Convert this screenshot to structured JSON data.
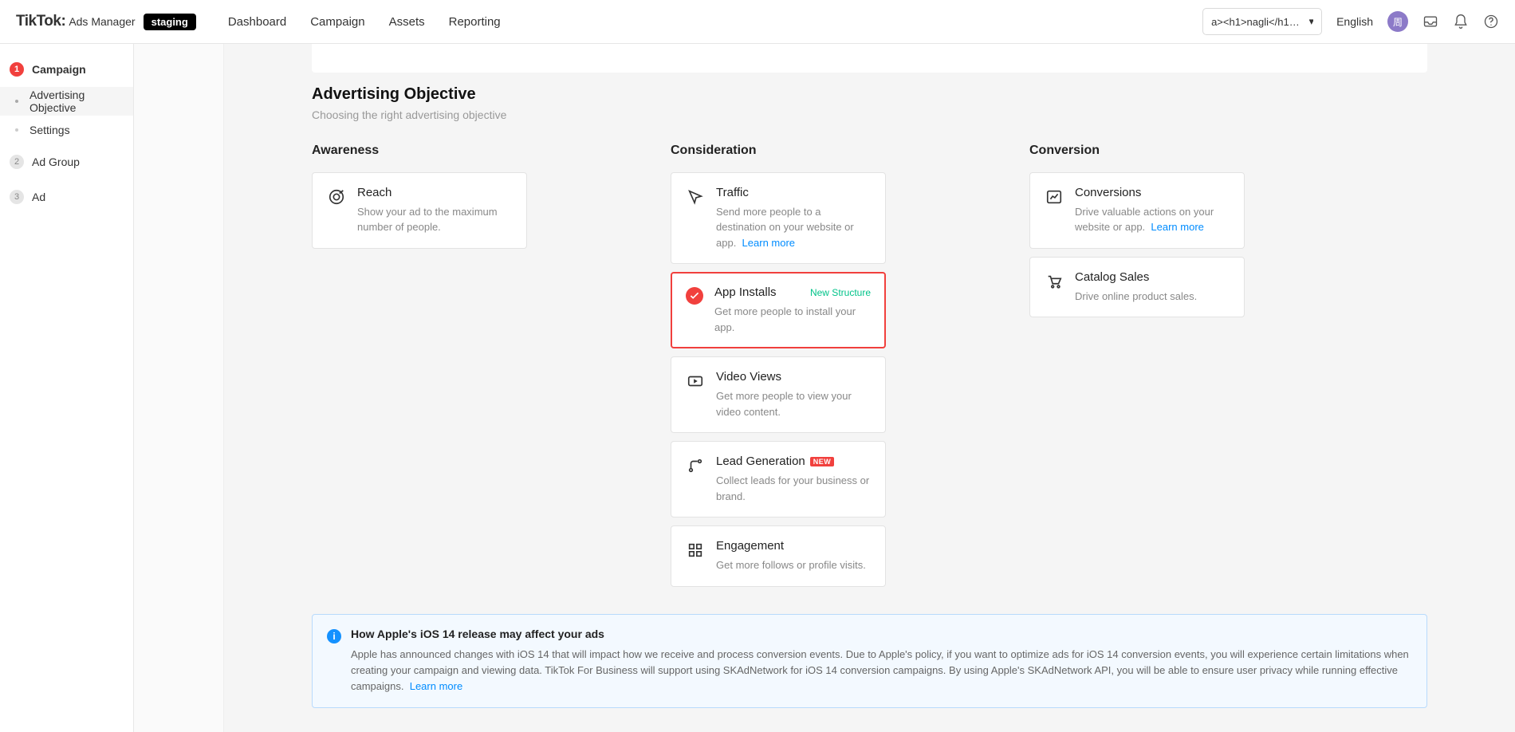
{
  "header": {
    "brand_name": "TikTok:",
    "brand_sub": "Ads Manager",
    "staging_label": "staging",
    "nav": [
      "Dashboard",
      "Campaign",
      "Assets",
      "Reporting"
    ],
    "account_text": "a><h1>nagli</h1><a …",
    "language": "English",
    "avatar_initial": "周"
  },
  "sidebar": {
    "steps": [
      {
        "num": "1",
        "label": "Campaign",
        "subs": [
          "Advertising Objective",
          "Settings"
        ]
      },
      {
        "num": "2",
        "label": "Ad Group",
        "subs": []
      },
      {
        "num": "3",
        "label": "Ad",
        "subs": []
      }
    ]
  },
  "page": {
    "title": "Advertising Objective",
    "subtitle": "Choosing the right advertising objective"
  },
  "columns": {
    "awareness": {
      "heading": "Awareness",
      "cards": [
        {
          "title": "Reach",
          "desc": "Show your ad to the maximum number of people."
        }
      ]
    },
    "consideration": {
      "heading": "Consideration",
      "cards": [
        {
          "title": "Traffic",
          "desc": "Send more people to a destination on your website or app.",
          "learn_more": "Learn more"
        },
        {
          "title": "App Installs",
          "desc": "Get more people to install your app.",
          "badge": "New Structure",
          "selected": true
        },
        {
          "title": "Video Views",
          "desc": "Get more people to view your video content."
        },
        {
          "title": "Lead Generation",
          "desc": "Collect leads for your business or brand.",
          "new": "NEW"
        },
        {
          "title": "Engagement",
          "desc": "Get more follows or profile visits."
        }
      ]
    },
    "conversion": {
      "heading": "Conversion",
      "cards": [
        {
          "title": "Conversions",
          "desc": "Drive valuable actions on your website or app.",
          "learn_more": "Learn more"
        },
        {
          "title": "Catalog Sales",
          "desc": "Drive online product sales."
        }
      ]
    }
  },
  "notice": {
    "title": "How Apple's iOS 14 release may affect your ads",
    "body": "Apple has announced changes with iOS 14 that will impact how we receive and process conversion events. Due to Apple's policy, if you want to optimize ads for iOS 14 conversion events, you will experience certain limitations when creating your campaign and viewing data. TikTok For Business will support using SKAdNetwork for iOS 14 conversion campaigns. By using Apple's SKAdNetwork API, you will be able to ensure user privacy while running effective campaigns.",
    "learn_more": "Learn more"
  }
}
